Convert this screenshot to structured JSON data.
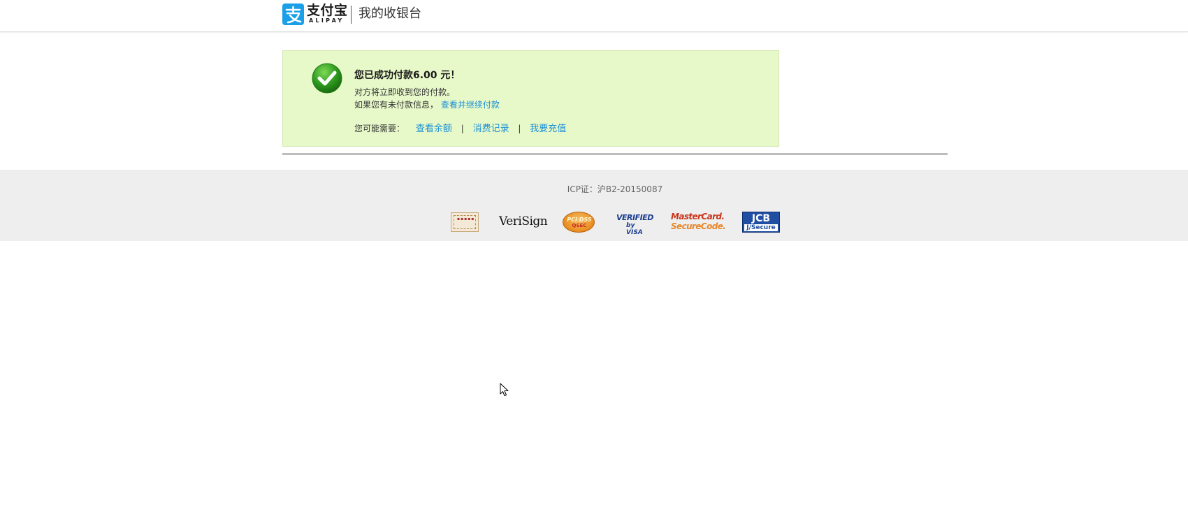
{
  "header": {
    "logo_cn": "支付宝",
    "logo_en": "ALIPAY",
    "title": "我的收银台"
  },
  "success": {
    "title": "您已成功付款6.00 元！",
    "line1": "对方将立即收到您的付款。",
    "line2_text": "如果您有未付款信息，",
    "line2_link": "查看并继续付款",
    "needs_label": "您可能需要：",
    "links": [
      "查看余额",
      "消费记录",
      "我要充值"
    ],
    "separator": "|"
  },
  "footer": {
    "icp": "ICP证：沪B2-20150087",
    "badges": {
      "verisign": "VeriSign",
      "pcidss": "PCI DSS",
      "pcidss_sub": "QSEC",
      "visa_line1": "VERIFIED",
      "visa_line2": "by VISA",
      "master_line1": "MasterCard.",
      "master_line2": "SecureCode.",
      "jcb_line1": "JCB",
      "jcb_line2": "J/Secure"
    }
  },
  "colors": {
    "alipay_blue": "#1a9fe8",
    "success_bg": "#e8f9c9",
    "link": "#1a8fd6",
    "footer_bg": "#eeeeee"
  },
  "icons": {
    "logo": "alipay-logo-icon",
    "check": "success-check-icon",
    "cursor": "mouse-cursor-icon"
  }
}
